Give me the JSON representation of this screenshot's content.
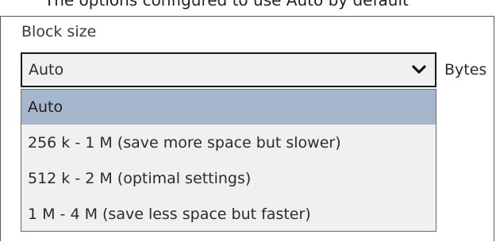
{
  "top_text": "The options configured to use Auto by default",
  "block_size": {
    "label": "Block size",
    "selected_value": "Auto",
    "unit_label": "Bytes",
    "options": [
      {
        "label": "Auto",
        "selected": true
      },
      {
        "label": "256 k - 1 M (save more space but slower)",
        "selected": false
      },
      {
        "label": "512 k - 2 M (optimal settings)",
        "selected": false
      },
      {
        "label": "1 M - 4 M (save less space but faster)",
        "selected": false
      }
    ]
  },
  "colors": {
    "highlight": "#a4b7cc",
    "dropdown_bg": "#f0f0f0",
    "border": "#1a1a1a"
  },
  "icons": {
    "dropdown": "chevron-down-icon"
  }
}
